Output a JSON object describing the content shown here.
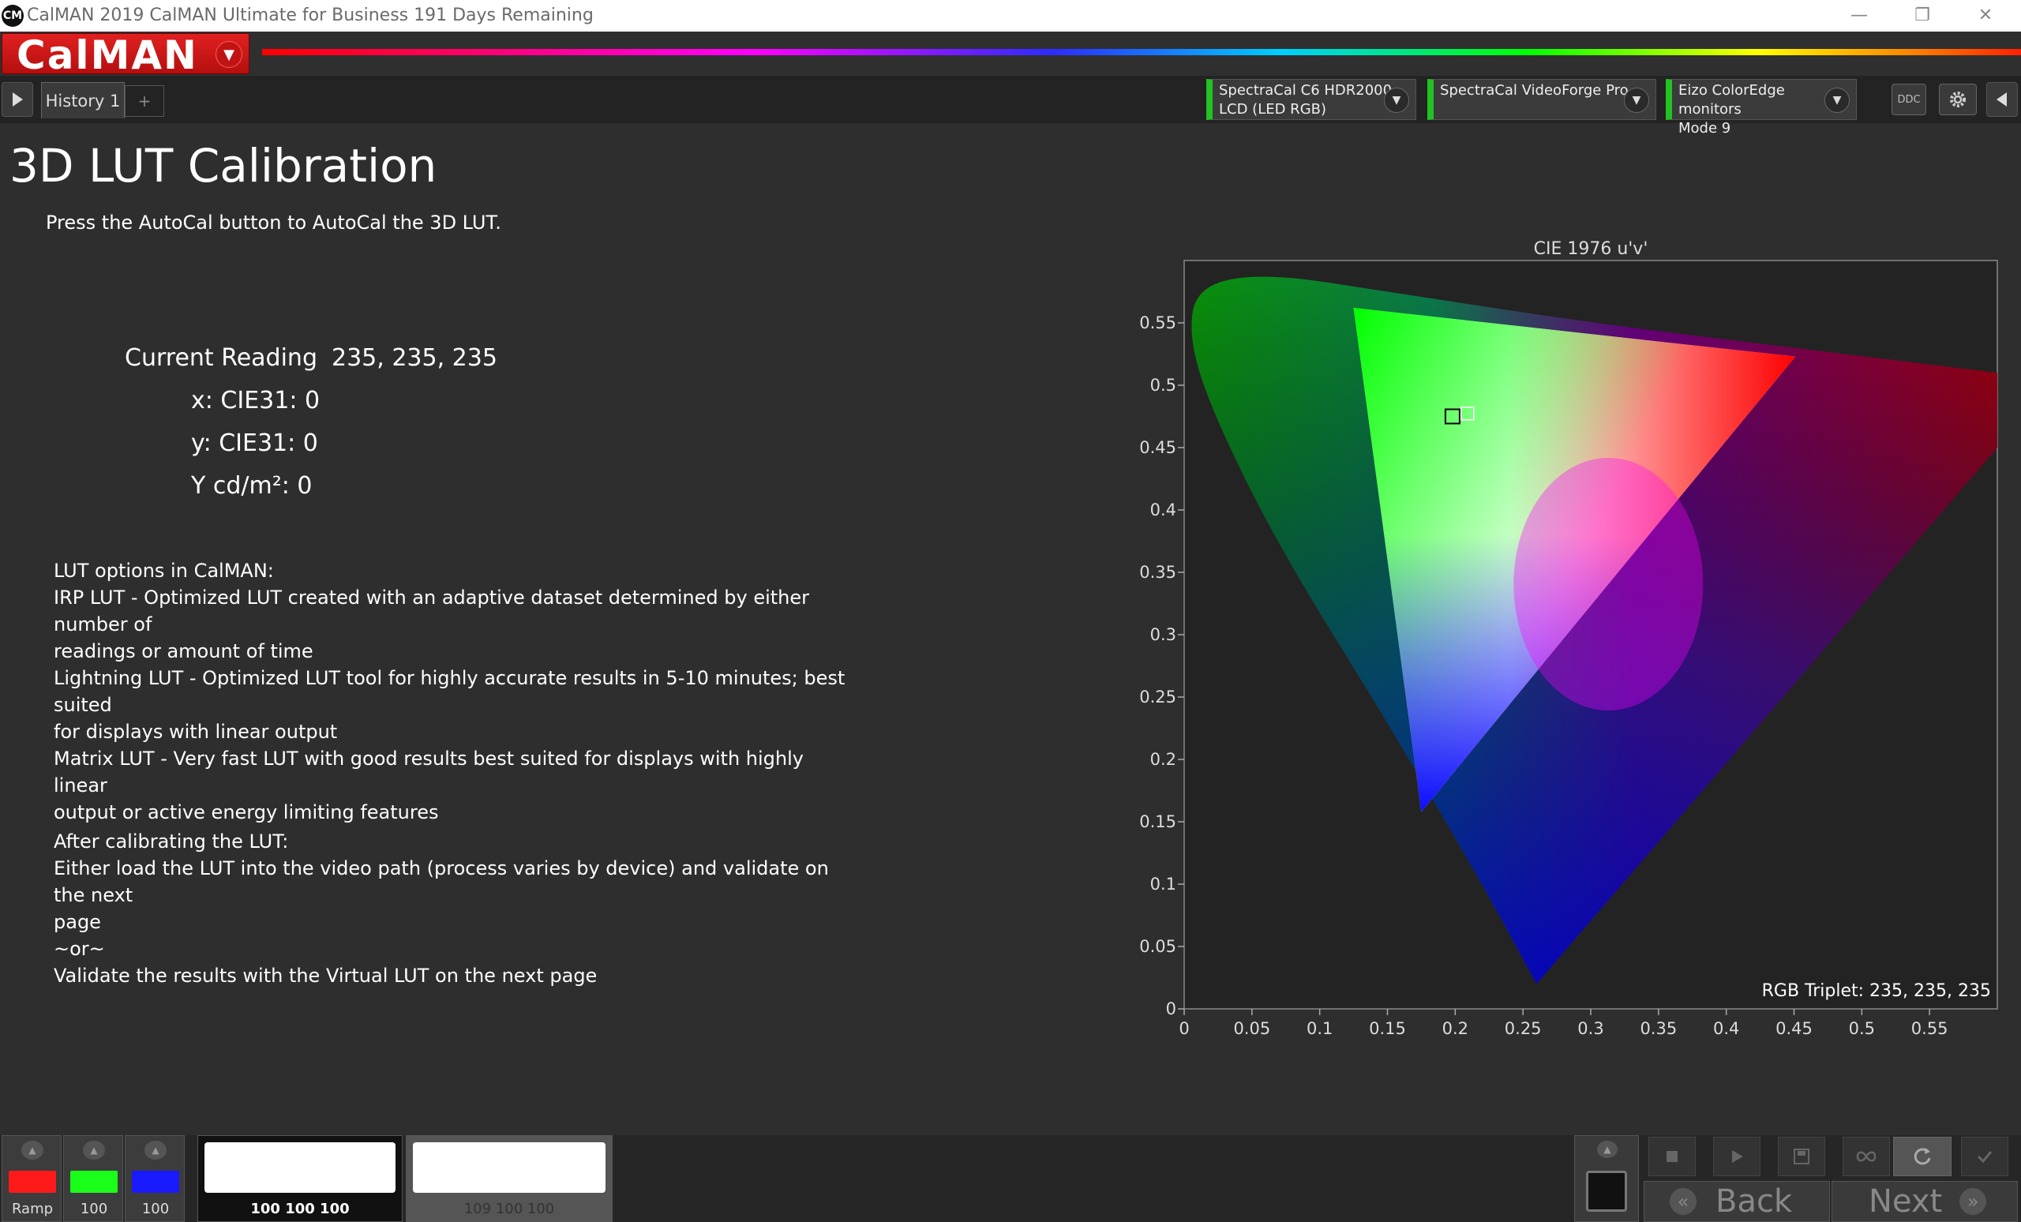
{
  "window": {
    "logo_text": "CM",
    "title": "CalMAN 2019 CalMAN Ultimate for Business 191 Days Remaining",
    "minimize": "—",
    "restore": "❐",
    "close": "✕"
  },
  "header": {
    "brand": "CalMAN",
    "brand_menu": "▼"
  },
  "tabs": {
    "history": "History 1",
    "add": "+"
  },
  "devices": [
    {
      "line1": "SpectraCal C6 HDR2000",
      "line2": "LCD (LED RGB)"
    },
    {
      "line1": "SpectraCal VideoForge Pro",
      "line2": ""
    },
    {
      "line1": "Eizo ColorEdge monitors",
      "line2": "Mode 9"
    }
  ],
  "toolbar": {
    "ddc": "DDC",
    "dropdown": "▼"
  },
  "page": {
    "title": "3D LUT Calibration",
    "instruction": "Press the AutoCal button to AutoCal the 3D LUT."
  },
  "reading": {
    "label": "Current Reading",
    "value": "235, 235, 235",
    "x": "x: CIE31: 0",
    "y": "y: CIE31: 0",
    "Y": "Y cd/m²: 0"
  },
  "lut_options": {
    "heading": "LUT options in CalMAN:",
    "irp_1": "IRP LUT - Optimized LUT created with an adaptive dataset determined by either number of",
    "irp_2": "readings or amount of time",
    "lightning_1": "Lightning LUT - Optimized LUT tool for highly accurate results in 5-10 minutes; best suited",
    "lightning_2": "for displays with linear output",
    "matrix_1": "Matrix LUT - Very fast LUT with good results best suited for displays with highly linear",
    "matrix_2": "output or active energy limiting features"
  },
  "after": {
    "heading": "After calibrating the LUT:",
    "line1": "Either load the LUT into the video path (process varies by device) and validate on the next",
    "line2": "page",
    "line3": "~or~",
    "line4": "Validate the results with the Virtual LUT on the next page"
  },
  "chart_data": {
    "type": "scatter",
    "title": "CIE 1976 u'v'",
    "xlabel": "",
    "ylabel": "",
    "xlim": [
      0,
      0.6
    ],
    "ylim": [
      0,
      0.6
    ],
    "x_ticks": [
      "0",
      "0.05",
      "0.1",
      "0.15",
      "0.2",
      "0.25",
      "0.3",
      "0.35",
      "0.4",
      "0.45",
      "0.5",
      "0.55"
    ],
    "y_ticks": [
      "0",
      "0.05",
      "0.1",
      "0.15",
      "0.2",
      "0.25",
      "0.3",
      "0.35",
      "0.4",
      "0.45",
      "0.5",
      "0.55"
    ],
    "spectral_locus": [
      [
        0.26,
        0.02
      ],
      [
        0.22,
        0.1
      ],
      [
        0.15,
        0.23
      ],
      [
        0.07,
        0.37
      ],
      [
        0.02,
        0.48
      ],
      [
        0.003,
        0.54
      ],
      [
        0.01,
        0.58
      ],
      [
        0.06,
        0.59
      ],
      [
        0.15,
        0.575
      ],
      [
        0.3,
        0.55
      ],
      [
        0.45,
        0.53
      ],
      [
        0.6,
        0.51
      ]
    ],
    "gamut_triangle": {
      "red": [
        0.451,
        0.523
      ],
      "green": [
        0.125,
        0.562
      ],
      "blue": [
        0.175,
        0.158
      ]
    },
    "target_point": [
      0.198,
      0.475
    ],
    "measured_point": [
      0.209,
      0.476
    ],
    "annotation": "RGB Triplet: 235, 235, 235"
  },
  "bottom": {
    "swatches": [
      {
        "label": "Ramp",
        "color": "#ff1a1a"
      },
      {
        "label": "100",
        "color": "#1aff1a"
      },
      {
        "label": "100",
        "color": "#1a1aff"
      }
    ],
    "patch_current": "100 100 100",
    "patch_next": "109 100 100",
    "back": "Back",
    "next": "Next",
    "back_icon": "«",
    "next_icon": "»"
  }
}
